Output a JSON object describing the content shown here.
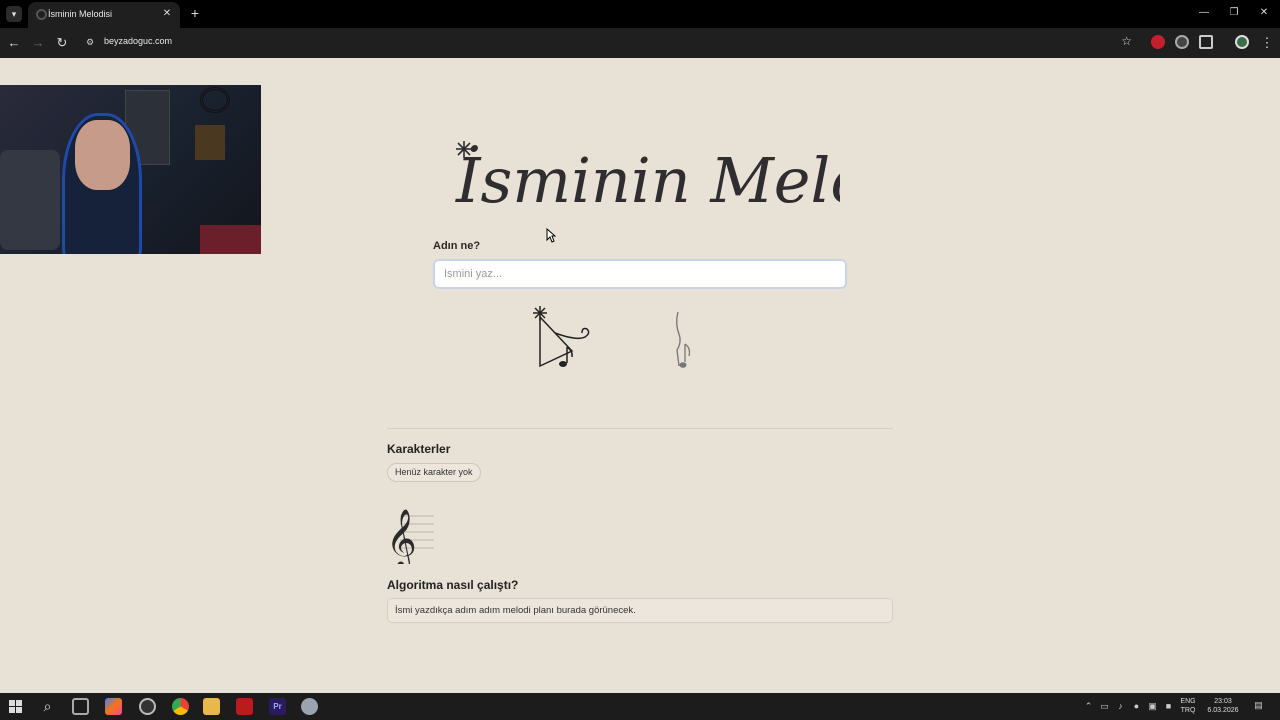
{
  "browser": {
    "tab_title": "İsminin Melodisi",
    "url": "beyzadoguc.com"
  },
  "page": {
    "title": "İsminin Melodisi",
    "name_label": "Adın ne?",
    "name_input": {
      "value": "",
      "placeholder": "İsmini yaz..."
    },
    "characters_title": "Karakterler",
    "characters_chip": "Henüz karakter yok",
    "algorithm_title": "Algoritma nasıl çalıştı?",
    "algorithm_text": "İsmi yazdıkça adım adım melodi planı burada görünecek."
  },
  "taskbar": {
    "language": "ENG",
    "layout": "TRQ",
    "time": "23:03",
    "date": "6.03.2026"
  },
  "colors": {
    "page_bg": "#e8e1d6",
    "title_ink": "#2f2d2f",
    "chrome_bg": "#1f1f1f"
  }
}
